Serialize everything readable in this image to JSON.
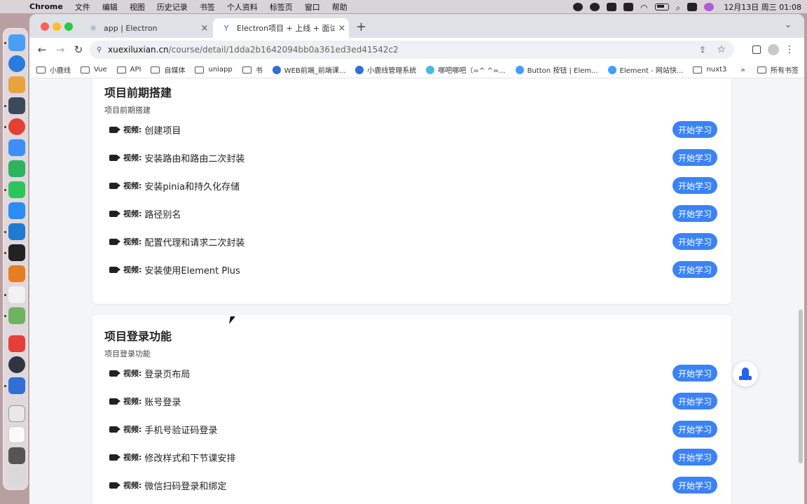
{
  "menubar": {
    "app": "Chrome",
    "items": [
      "文件",
      "编辑",
      "视图",
      "历史记录",
      "书签",
      "个人资料",
      "标签页",
      "窗口",
      "帮助"
    ],
    "clock": "12月13日 周三  01:08"
  },
  "browser": {
    "tabs": [
      {
        "title": "app | Electron",
        "active": false
      },
      {
        "title": "Electron项目 + 上线 + 面试_WE",
        "active": true
      }
    ],
    "url_host": "xuexiluxian.cn",
    "url_path": "/course/detail/1dda2b1642094bb0a361ed3ed41542c2",
    "bookmarks": [
      {
        "label": "小鹿线",
        "type": "folder"
      },
      {
        "label": "Vue",
        "type": "folder"
      },
      {
        "label": "API",
        "type": "folder"
      },
      {
        "label": "自媒体",
        "type": "folder"
      },
      {
        "label": "uniapp",
        "type": "folder"
      },
      {
        "label": "书",
        "type": "folder"
      },
      {
        "label": "WEB前端_前端课...",
        "type": "site",
        "color": "#2f6fd6"
      },
      {
        "label": "小鹿线管理系统",
        "type": "site",
        "color": "#2f6fd6"
      },
      {
        "label": "哪吧哪吧（=^ ^=...",
        "type": "site",
        "color": "#4db6e8"
      },
      {
        "label": "Button 按钮 | Elem...",
        "type": "site",
        "color": "#409eff"
      },
      {
        "label": "Element - 网站快...",
        "type": "site",
        "color": "#409eff"
      },
      {
        "label": "nuxt3",
        "type": "folder"
      }
    ],
    "bookmarks_more": "»",
    "bookmarks_all": "所有书签"
  },
  "page": {
    "sections": [
      {
        "title": "项目前期搭建",
        "subtitle": "项目前期搭建",
        "lessons": [
          {
            "kind": "视频:",
            "title": "创建项目",
            "button": "开始学习"
          },
          {
            "kind": "视频:",
            "title": "安装路由和路由二次封装",
            "button": "开始学习"
          },
          {
            "kind": "视频:",
            "title": "安装pinia和持久化存储",
            "button": "开始学习"
          },
          {
            "kind": "视频:",
            "title": "路径别名",
            "button": "开始学习"
          },
          {
            "kind": "视频:",
            "title": "配置代理和请求二次封装",
            "button": "开始学习"
          },
          {
            "kind": "视频:",
            "title": "安装使用Element Plus",
            "button": "开始学习"
          }
        ]
      },
      {
        "title": "项目登录功能",
        "subtitle": "项目登录功能",
        "lessons": [
          {
            "kind": "视频:",
            "title": "登录页布局",
            "button": "开始学习"
          },
          {
            "kind": "视频:",
            "title": "账号登录",
            "button": "开始学习"
          },
          {
            "kind": "视频:",
            "title": "手机号验证码登录",
            "button": "开始学习"
          },
          {
            "kind": "视频:",
            "title": "修改样式和下节课安排",
            "button": "开始学习"
          },
          {
            "kind": "视频:",
            "title": "微信扫码登录和绑定",
            "button": "开始学习"
          }
        ]
      }
    ]
  },
  "colors": {
    "accent": "#3b82f6",
    "rocket": "#2563eb"
  }
}
